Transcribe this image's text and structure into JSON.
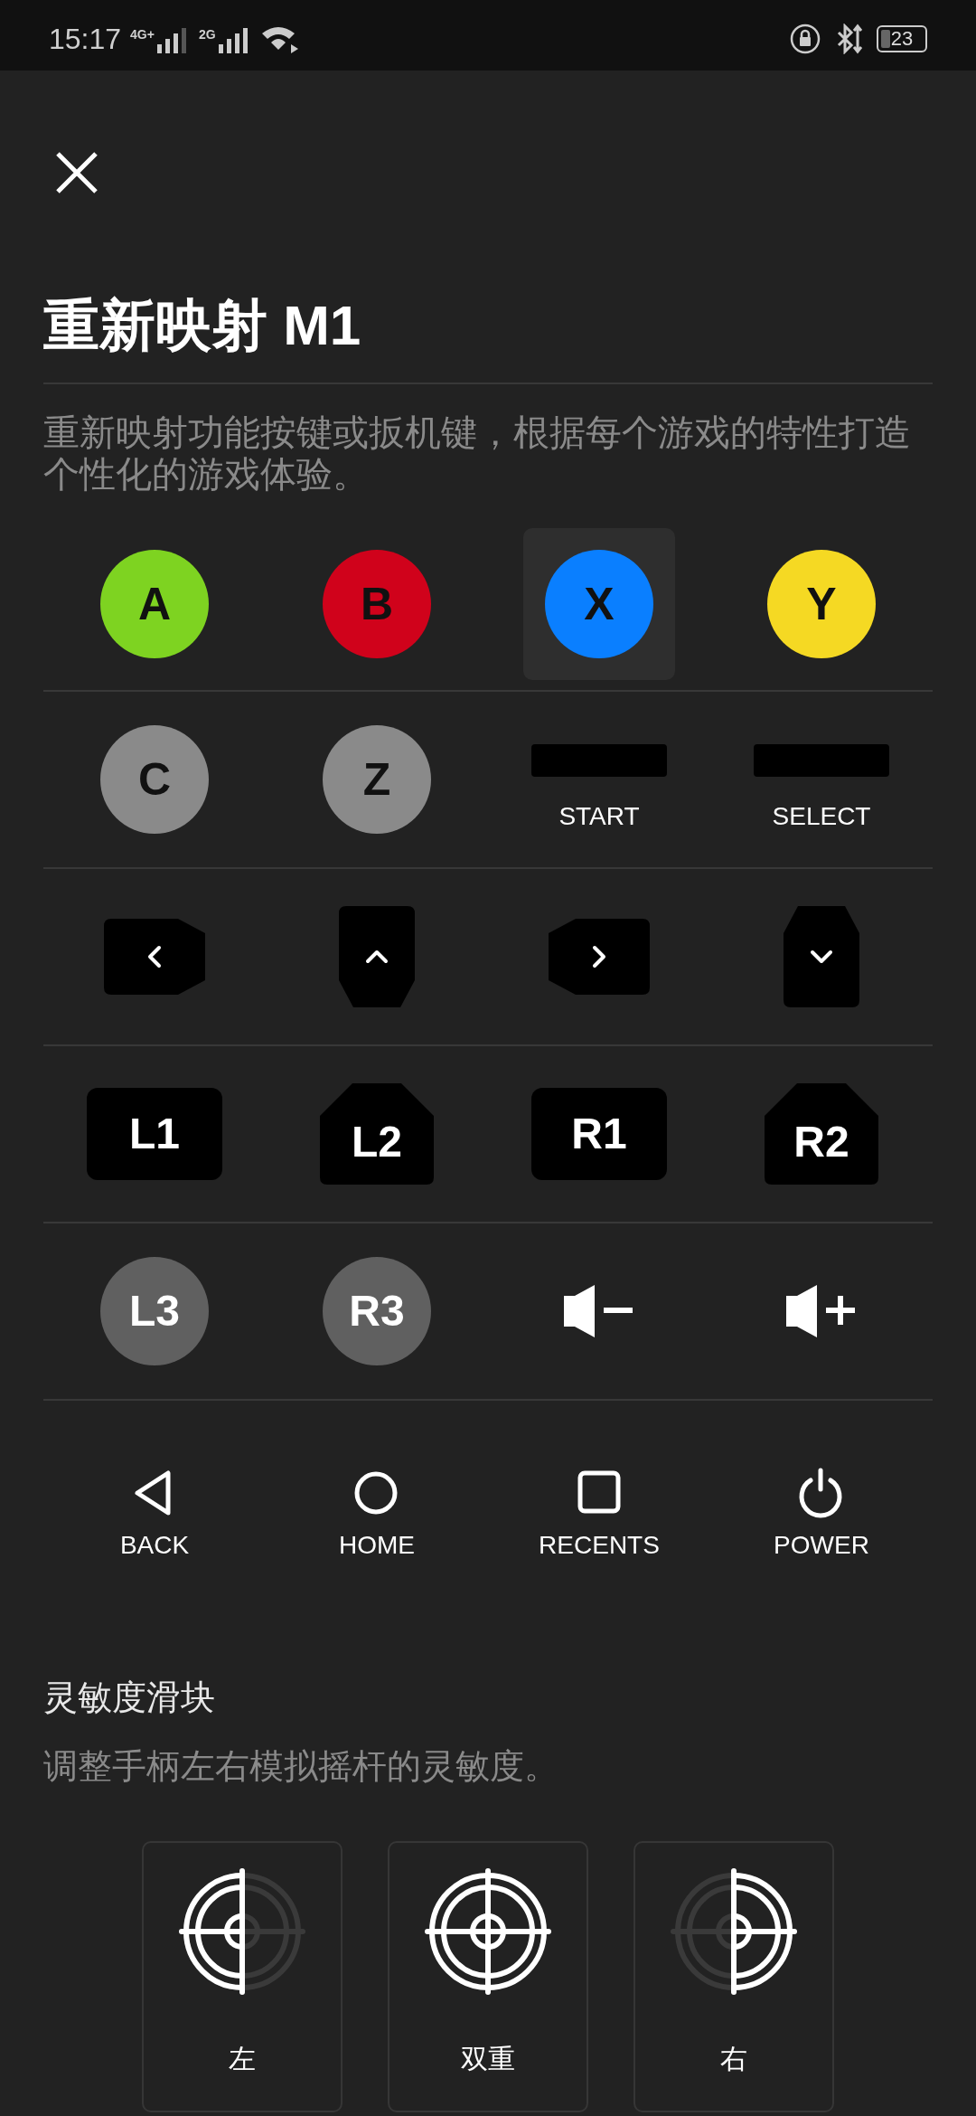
{
  "status_bar": {
    "time": "15:17",
    "network_1": "4G+",
    "network_2": "2G",
    "battery": "23"
  },
  "title": "重新映射 M1",
  "description": "重新映射功能按键或扳机键，根据每个游戏的特性打造个性化的游戏体验。",
  "button_rows": [
    [
      {
        "kind": "round",
        "label": "A",
        "color": "#7ed321",
        "selected": false
      },
      {
        "kind": "round",
        "label": "B",
        "color": "#d0021b",
        "selected": false
      },
      {
        "kind": "round",
        "label": "X",
        "color": "#0a7fff",
        "selected": true
      },
      {
        "kind": "round",
        "label": "Y",
        "color": "#f5d923",
        "selected": false
      }
    ],
    [
      {
        "kind": "round",
        "label": "C",
        "color": "#8a8a8a",
        "selected": false
      },
      {
        "kind": "round",
        "label": "Z",
        "color": "#8a8a8a",
        "selected": false
      },
      {
        "kind": "bar",
        "label": "START",
        "selected": false
      },
      {
        "kind": "bar",
        "label": "SELECT",
        "selected": false
      }
    ],
    [
      {
        "kind": "left",
        "selected": false
      },
      {
        "kind": "up",
        "selected": false
      },
      {
        "kind": "right",
        "selected": false
      },
      {
        "kind": "down",
        "selected": false
      }
    ],
    [
      {
        "kind": "bumper",
        "label": "L1",
        "selected": false
      },
      {
        "kind": "trigger",
        "label": "L2",
        "selected": false
      },
      {
        "kind": "bumper",
        "label": "R1",
        "selected": false
      },
      {
        "kind": "trigger",
        "label": "R2",
        "selected": false
      }
    ],
    [
      {
        "kind": "stick",
        "label": "L3",
        "selected": false
      },
      {
        "kind": "stick",
        "label": "R3",
        "selected": false
      },
      {
        "kind": "volumedown",
        "selected": false
      },
      {
        "kind": "volumeup",
        "selected": false
      }
    ],
    [
      {
        "kind": "back",
        "label": "BACK",
        "selected": false
      },
      {
        "kind": "home",
        "label": "HOME",
        "selected": false
      },
      {
        "kind": "recents",
        "label": "RECENTS",
        "selected": false
      },
      {
        "kind": "power",
        "label": "POWER",
        "selected": false
      }
    ]
  ],
  "sensitivity": {
    "title": "灵敏度滑块",
    "description": "调整手柄左右模拟摇杆的灵敏度。",
    "options": [
      {
        "kind": "left",
        "label": "左"
      },
      {
        "kind": "both",
        "label": "双重"
      },
      {
        "kind": "right",
        "label": "右"
      }
    ]
  }
}
